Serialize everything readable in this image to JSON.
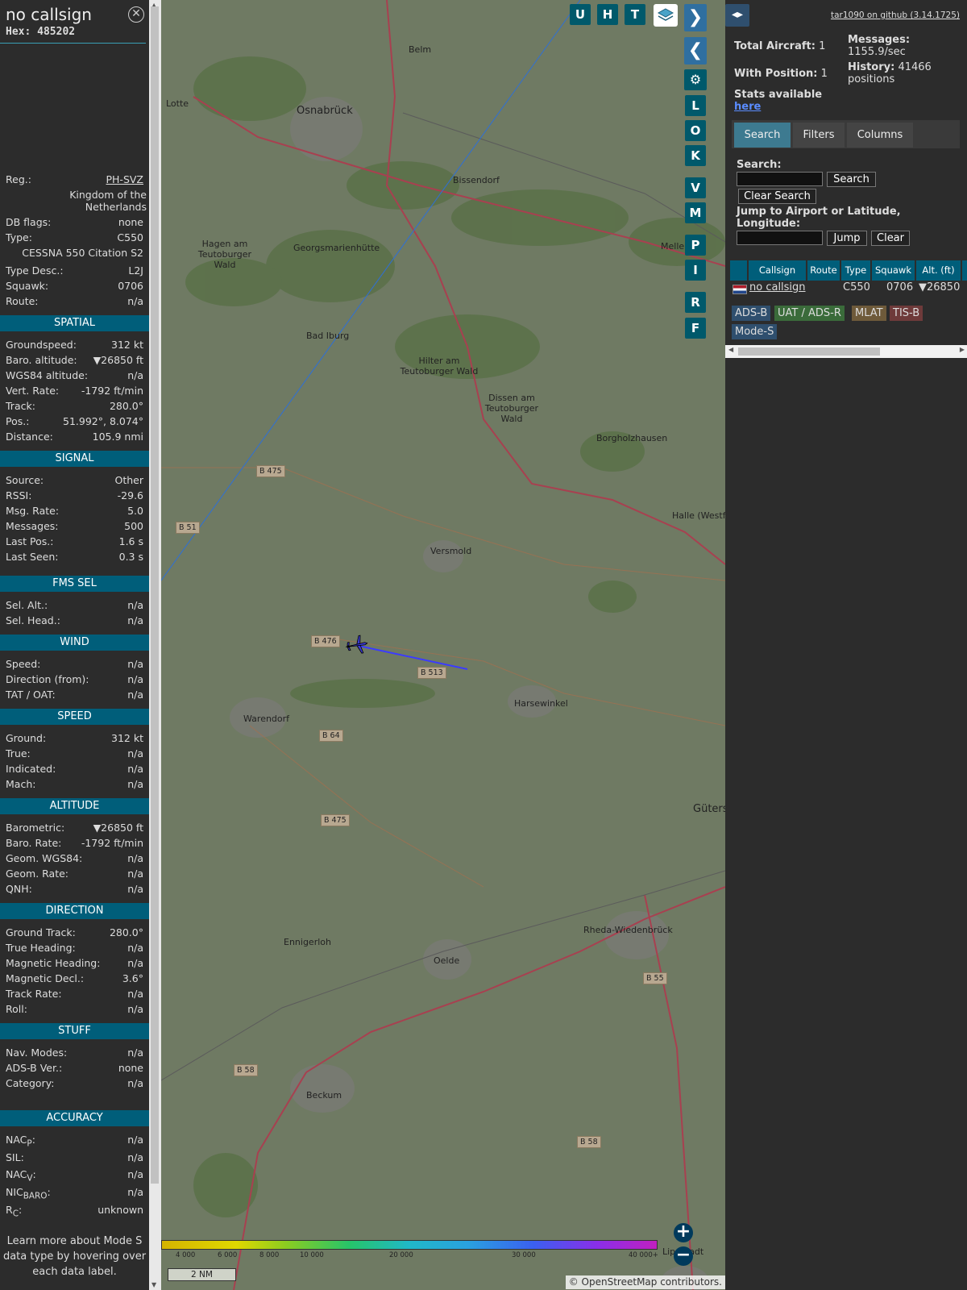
{
  "header": {
    "callsign": "no callsign",
    "hex": "Hex: 485202"
  },
  "info": {
    "reg_label": "Reg.:",
    "reg": "PH-SVZ",
    "country_line1": "Kingdom of the",
    "country_line2": "Netherlands",
    "dbflags_label": "DB flags:",
    "dbflags": "none",
    "type_label": "Type:",
    "type": "C550",
    "type_full": "CESSNA 550 Citation S2",
    "typedesc_label": "Type Desc.:",
    "typedesc": "L2J",
    "squawk_label": "Squawk:",
    "squawk": "0706",
    "route_label": "Route:",
    "route": "n/a"
  },
  "sections": {
    "spatial": "SPATIAL",
    "signal": "SIGNAL",
    "fms": "FMS SEL",
    "wind": "WIND",
    "speed": "SPEED",
    "altitude": "ALTITUDE",
    "direction": "DIRECTION",
    "stuff": "STUFF",
    "accuracy": "ACCURACY"
  },
  "spatial": [
    [
      "Groundspeed:",
      "312 kt"
    ],
    [
      "Baro. altitude:",
      "▼26850 ft"
    ],
    [
      "WGS84 altitude:",
      "n/a"
    ],
    [
      "Vert. Rate:",
      "-1792 ft/min"
    ],
    [
      "Track:",
      "280.0°"
    ],
    [
      "Pos.:",
      "51.992°, 8.074°"
    ],
    [
      "Distance:",
      "105.9 nmi"
    ]
  ],
  "signal": [
    [
      "Source:",
      "Other"
    ],
    [
      "RSSI:",
      "-29.6"
    ],
    [
      "Msg. Rate:",
      "5.0"
    ],
    [
      "Messages:",
      "500"
    ],
    [
      "Last Pos.:",
      "1.6 s"
    ],
    [
      "Last Seen:",
      "0.3 s"
    ]
  ],
  "fms": [
    [
      "Sel. Alt.:",
      "n/a"
    ],
    [
      "Sel. Head.:",
      "n/a"
    ]
  ],
  "wind": [
    [
      "Speed:",
      "n/a"
    ],
    [
      "Direction (from):",
      "n/a"
    ],
    [
      "TAT / OAT:",
      "n/a"
    ]
  ],
  "speed": [
    [
      "Ground:",
      "312 kt"
    ],
    [
      "True:",
      "n/a"
    ],
    [
      "Indicated:",
      "n/a"
    ],
    [
      "Mach:",
      "n/a"
    ]
  ],
  "altitude": [
    [
      "Barometric:",
      "▼26850 ft"
    ],
    [
      "Baro. Rate:",
      "-1792 ft/min"
    ],
    [
      "Geom. WGS84:",
      "n/a"
    ],
    [
      "Geom. Rate:",
      "n/a"
    ],
    [
      "QNH:",
      "n/a"
    ]
  ],
  "direction": [
    [
      "Ground Track:",
      "280.0°"
    ],
    [
      "True Heading:",
      "n/a"
    ],
    [
      "Magnetic Heading:",
      "n/a"
    ],
    [
      "Magnetic Decl.:",
      "3.6°"
    ],
    [
      "Track Rate:",
      "n/a"
    ],
    [
      "Roll:",
      "n/a"
    ]
  ],
  "stuff": [
    [
      "Nav. Modes:",
      "n/a"
    ],
    [
      "ADS-B Ver.:",
      "none"
    ],
    [
      "Category:",
      "n/a"
    ]
  ],
  "accuracy": {
    "nacp_label": "NAC",
    "nacp_sub": "P",
    "nacp": "n/a",
    "sil_label": "SIL:",
    "sil": "n/a",
    "nacv_label": "NAC",
    "nacv_sub": "V",
    "nacv": "n/a",
    "nicbaro_label": "NIC",
    "nicbaro_sub": "BARO",
    "nicbaro": "n/a",
    "rc_label": "R",
    "rc_sub": "C",
    "rc": "unknown"
  },
  "note": "Learn more about Mode S data type by hovering over each data label.",
  "map_buttons": {
    "top": [
      "U",
      "H",
      "T"
    ],
    "side": [
      "L",
      "O",
      "K",
      "V",
      "M",
      "P",
      "I",
      "R",
      "F"
    ]
  },
  "map_labels": [
    "Belm",
    "Osnabrück",
    "Lotte",
    "Bissendorf",
    "Hagen am Teutoburger Wald",
    "Georgsmarienhütte",
    "Melle",
    "Bad Iburg",
    "Hilter am Teutoburger Wald",
    "Dissen am Teutoburger Wald",
    "Borgholzhausen",
    "Versmold",
    "Halle (Westf.",
    "Harsewinkel",
    "Warendorf",
    "Güters",
    "Ennigerloh",
    "Oelde",
    "Rheda-Wiedenbrück",
    "Beckum",
    "Lippstadt"
  ],
  "roads": [
    "B 475",
    "B 51",
    "B 476",
    "B 513",
    "B 64",
    "B 475",
    "B 55",
    "B 58",
    "B 58"
  ],
  "altitude_scale": [
    "4 000",
    "6 000",
    "8 000",
    "10 000",
    "20 000",
    "30 000",
    "40 000+"
  ],
  "scale_bar": "2 NM",
  "attribution": "© OpenStreetMap contributors.",
  "right": {
    "github": "tar1090 on github (3.14.1725)",
    "total_label": "Total Aircraft:",
    "total": "1",
    "withpos_label": "With Position:",
    "withpos": "1",
    "messages_label": "Messages:",
    "messages": "1155.9/sec",
    "history_label": "History:",
    "history": "41466 positions",
    "stats_label": "Stats available",
    "stats_link": "here",
    "tabs": [
      "Search",
      "Filters",
      "Columns"
    ],
    "search_label": "Search:",
    "search_btn": "Search",
    "clear_search_btn": "Clear Search",
    "jump_label": "Jump to Airport or Latitude, Longitude:",
    "jump_btn": "Jump",
    "clear_btn": "Clear",
    "columns": [
      "Callsign",
      "Route",
      "Type",
      "Squawk",
      "Alt. (ft)"
    ],
    "row": {
      "callsign": "no callsign",
      "route": "",
      "type": "C550",
      "squawk": "0706",
      "alt": "▼26850"
    },
    "chips": [
      "ADS-B",
      "UAT / ADS-R",
      "MLAT",
      "TIS-B",
      "Mode-S"
    ]
  },
  "colors": {
    "accent": "#005e7a",
    "panel": "#2c2c2c",
    "chip_adsb": "#2f4f6e",
    "chip_uat": "#3a6b3a",
    "chip_mlat": "#6e5a3a",
    "chip_tisb": "#6e3a3a",
    "chip_modes": "#2f4f6e"
  }
}
